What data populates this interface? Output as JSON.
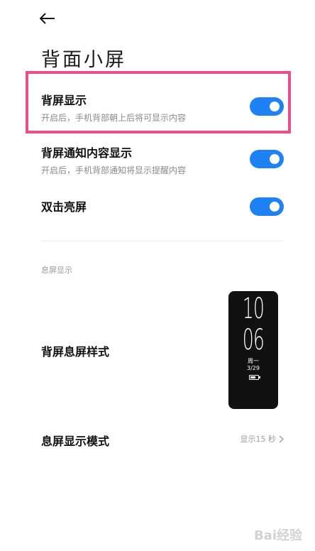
{
  "page": {
    "title": "背面小屏"
  },
  "settings": [
    {
      "title": "背屏显示",
      "subtitle": "开启后，手机背部朝上后将可显示内容",
      "enabled": true
    },
    {
      "title": "背屏通知内容显示",
      "subtitle": "开启后，手机背部通知将显示提醒内容",
      "enabled": true
    },
    {
      "title": "双击亮屏",
      "subtitle": "",
      "enabled": true
    }
  ],
  "section": {
    "label": "息屏显示",
    "style_title": "背屏息屏样式",
    "preview": {
      "hour": "10",
      "minute": "06",
      "weekday": "周一",
      "date": "3/29"
    },
    "mode_title": "息屏显示模式",
    "mode_value": "显示15 秒"
  },
  "colors": {
    "accent": "#1e82f5",
    "highlight": "#e8508a"
  },
  "watermark": "Bai经验"
}
